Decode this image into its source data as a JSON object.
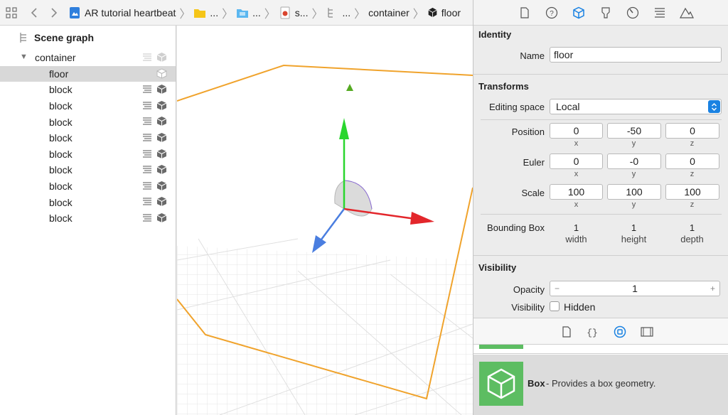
{
  "jumpbar": {
    "crumbs": {
      "project": "AR tutorial heartbeat",
      "folder1": "...",
      "folder2": "...",
      "scene": "s...",
      "node": "...",
      "container": "container",
      "floor": "floor"
    }
  },
  "scene_graph": {
    "title": "Scene graph",
    "root": "container",
    "items": [
      "floor",
      "block",
      "block",
      "block",
      "block",
      "block",
      "block",
      "block",
      "block",
      "block"
    ]
  },
  "inspector": {
    "identity": {
      "title": "Identity",
      "name_label": "Name",
      "name_value": "floor"
    },
    "transforms": {
      "title": "Transforms",
      "editing_space_label": "Editing space",
      "editing_space_value": "Local",
      "position_label": "Position",
      "position": [
        "0",
        "-50",
        "0"
      ],
      "euler_label": "Euler",
      "euler": [
        "0",
        "-0",
        "0"
      ],
      "scale_label": "Scale",
      "scale": [
        "100",
        "100",
        "100"
      ],
      "axes": [
        "x",
        "y",
        "z"
      ],
      "bounding_box_label": "Bounding Box",
      "bounding_box": [
        "1",
        "1",
        "1"
      ],
      "bounding_box_dims": [
        "width",
        "height",
        "depth"
      ]
    },
    "visibility": {
      "title": "Visibility",
      "opacity_label": "Opacity",
      "opacity_value": "1",
      "minus": "−",
      "plus": "+",
      "visibility_label": "Visibility",
      "hidden_label": "Hidden"
    }
  },
  "library": {
    "item_name": "Box",
    "item_desc": " - Provides a box geometry."
  },
  "colors": {
    "accent": "#1a82e2",
    "selection_box": "#f0a32c",
    "axis_x": "#e3262b",
    "axis_y": "#2ad62e",
    "axis_z": "#4a7ee0",
    "library_green": "#5dbd62"
  }
}
